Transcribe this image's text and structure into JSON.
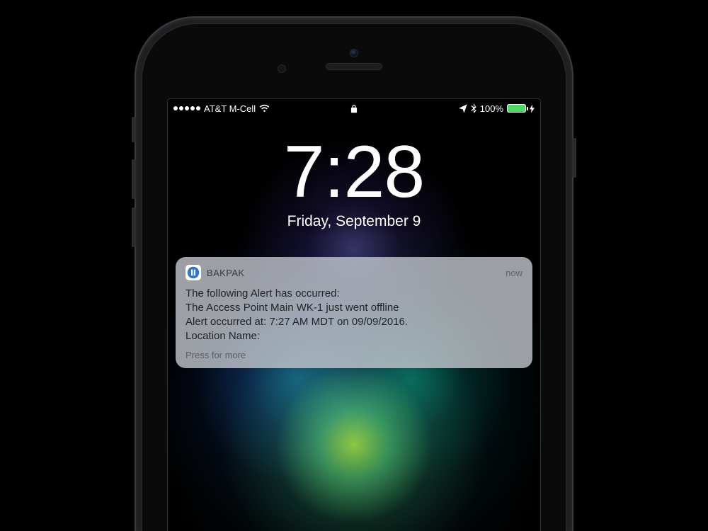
{
  "status": {
    "carrier": "AT&T M-Cell",
    "battery_pct": "100%"
  },
  "lock": {
    "time": "7:28",
    "date": "Friday, September 9"
  },
  "notif": {
    "app": "BAKPAK",
    "time": "now",
    "line1": "The following Alert has occurred:",
    "line2": "The Access Point Main WK-1 just went offline",
    "line3": "Alert occurred at: 7:27 AM MDT on 09/09/2016.",
    "line4": "Location Name:",
    "more": "Press for more"
  }
}
